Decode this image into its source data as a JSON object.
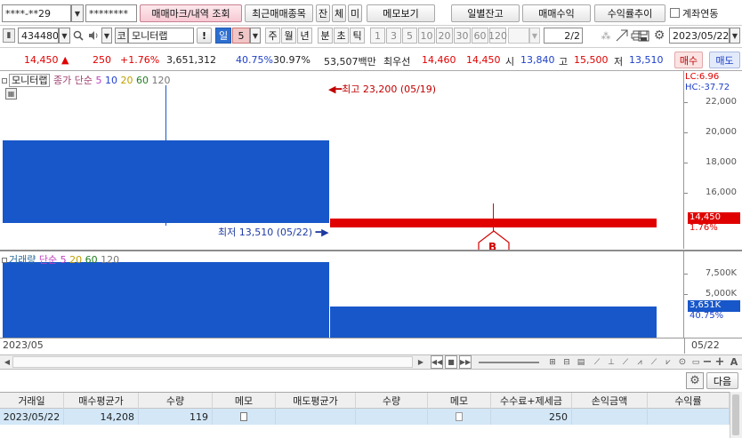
{
  "toolbar1": {
    "account": "****-**29",
    "password": "********",
    "tab_trade_marks": "매매마크/내역 조회",
    "recent_items": "최근매매종목",
    "btn_balance": "잔",
    "btn_fill": "체",
    "btn_unfilled": "미",
    "memo_view": "메모보기",
    "daily_balance": "일별잔고",
    "trade_profit": "매매수익",
    "return_trend": "수익률추이",
    "account_link": "계좌연동"
  },
  "toolbar2": {
    "code": "434480",
    "market_prefix": "코",
    "stock_name": "모니터랩",
    "period_day": "일",
    "period_n": "5",
    "week": "주",
    "month": "월",
    "year": "년",
    "minute": "분",
    "tick_s": "초",
    "tick": "틱",
    "intervals": [
      "1",
      "3",
      "5",
      "10",
      "20",
      "30",
      "60",
      "120"
    ],
    "page": "2",
    "page_total": "/2",
    "date": "2023/05/22"
  },
  "quote": {
    "price": "14,450",
    "change": "250",
    "change_pct": "+1.76%",
    "volume": "3,651,312",
    "vol_ratio": "40.75%",
    "turnover": "30.97%",
    "amount": "53,507백만",
    "best_label": "최우선",
    "ask": "14,460",
    "bid": "14,450",
    "open_label": "시",
    "open": "13,840",
    "high_label": "고",
    "high": "15,500",
    "low_label": "저",
    "low": "13,510",
    "buy": "매수",
    "sell": "매도"
  },
  "price_pane": {
    "legend_name": "모니터랩",
    "legend_close": "종가",
    "legend_ma": "단순",
    "ma": [
      "5",
      "10",
      "20",
      "60",
      "120"
    ],
    "max_label": "최고 23,200 (05/19)",
    "min_label": "최저 13,510 (05/22)",
    "lc": "LC:6.96",
    "hc": "HC:-37.72",
    "y_ticks": [
      "22,000",
      "20,000",
      "18,000",
      "16,000"
    ],
    "cur_price": "14,450",
    "cur_pct": "1.76%",
    "marker": "B"
  },
  "volume_pane": {
    "legend_name": "거래량",
    "legend_ma": "단순",
    "ma": [
      "5",
      "20",
      "60",
      "120"
    ],
    "y_ticks": [
      "7,500K",
      "5,000K"
    ],
    "cur_vol": "3,651K",
    "cur_pct": "40.75%"
  },
  "x_axis": {
    "left": "2023/05",
    "right": "05/22"
  },
  "next_button": "다음",
  "table": {
    "headers": [
      "거래일",
      "매수평균가",
      "수량",
      "메모",
      "매도평균가",
      "수량",
      "메모",
      "수수료+제세금",
      "손익금액",
      "수익률"
    ],
    "rows": [
      [
        "2023/05/22",
        "14,208",
        "119",
        "",
        "",
        "",
        "",
        "250",
        "",
        ""
      ]
    ]
  },
  "colors": {
    "up": "#e00000",
    "down": "#1e40c8",
    "bar": "#1857c9",
    "accent": "#2d6fd0"
  }
}
